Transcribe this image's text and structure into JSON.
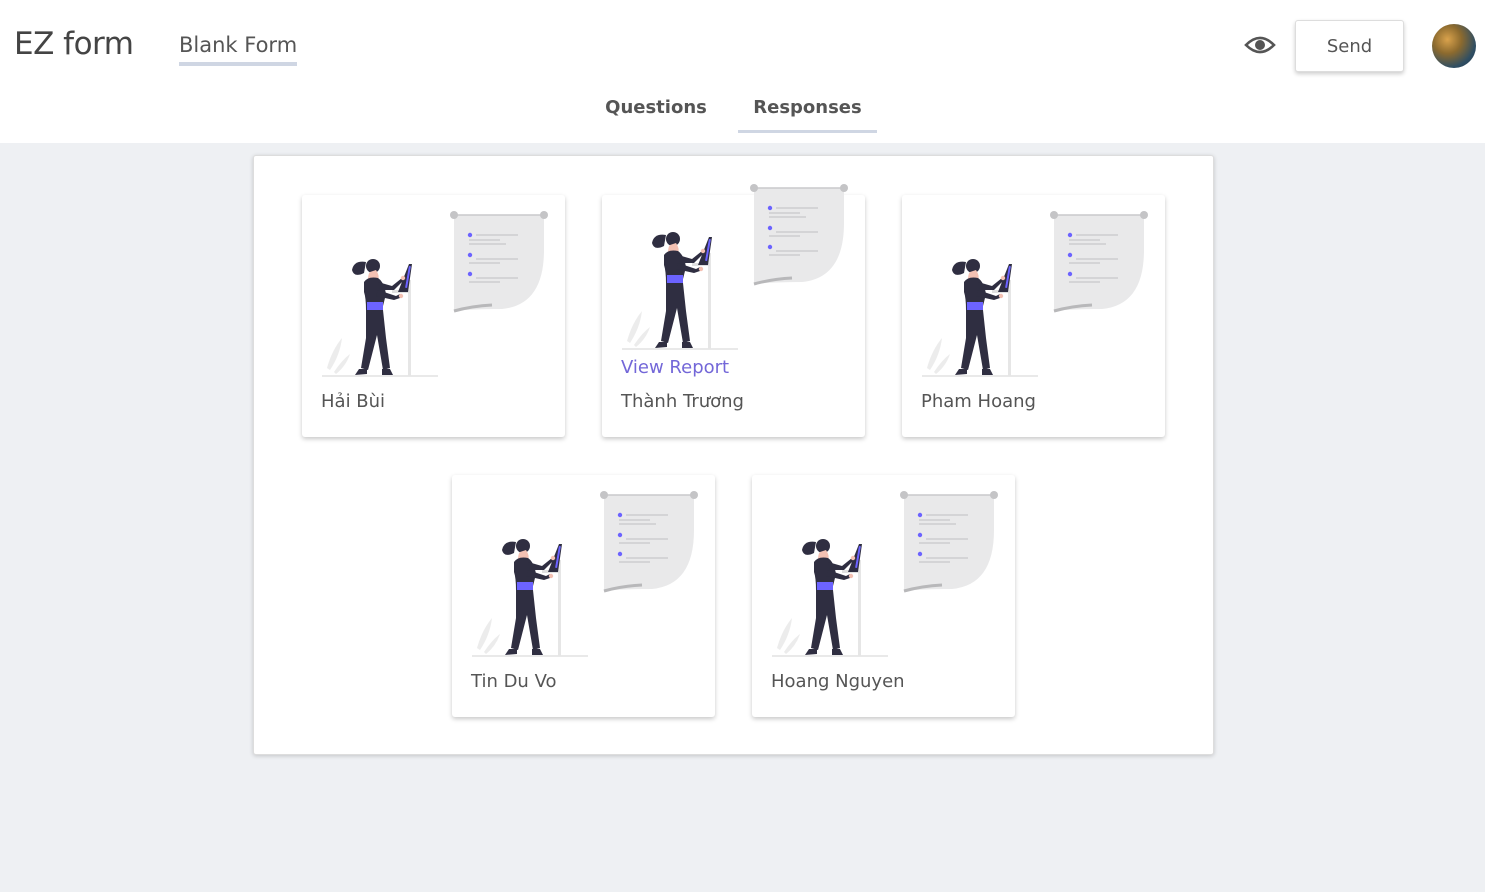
{
  "header": {
    "logo": "EZ form",
    "form_title": "Blank Form",
    "send_label": "Send"
  },
  "tabs": [
    {
      "label": "Questions"
    },
    {
      "label": "Responses"
    }
  ],
  "responses": [
    {
      "name": "Hải Bùi"
    },
    {
      "name": "Thành Trương",
      "action": "View Report"
    },
    {
      "name": "Pham Hoang"
    },
    {
      "name": "Tin Du Vo"
    },
    {
      "name": "Hoang Nguyen"
    }
  ],
  "colors": {
    "accent": "#7367d8",
    "tab_underline": "#cfd6e3",
    "page_background": "#eef0f3"
  },
  "icons": {
    "preview": "eye-icon",
    "avatar": "user-avatar"
  }
}
